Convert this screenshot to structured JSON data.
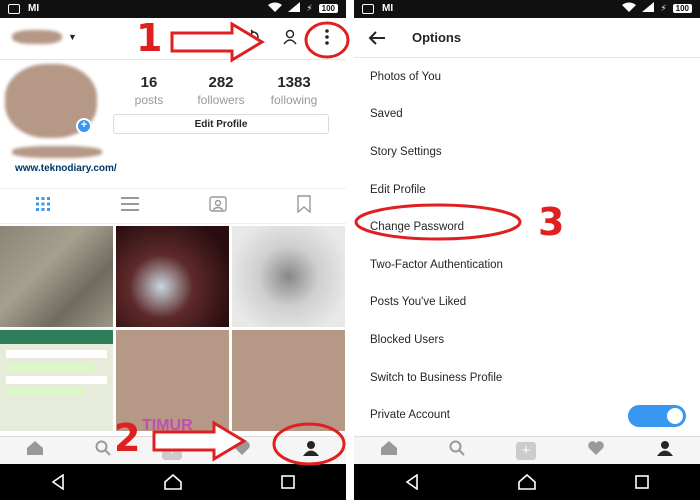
{
  "left_phone": {
    "status_bar": {
      "brand": "MI",
      "battery": "100"
    },
    "profile": {
      "posts_count": "16",
      "posts_label": "posts",
      "followers_count": "282",
      "followers_label": "followers",
      "following_count": "1383",
      "following_label": "following",
      "edit_button": "Edit Profile",
      "website": "www.teknodiary.com/"
    },
    "photo_overlay_text": "TIMUR"
  },
  "right_phone": {
    "status_bar": {
      "brand": "MI",
      "battery": "100"
    },
    "title": "Options",
    "items": [
      {
        "label": "Photos of You"
      },
      {
        "label": "Saved"
      },
      {
        "label": "Story Settings"
      },
      {
        "label": "Edit Profile"
      },
      {
        "label": "Change Password"
      },
      {
        "label": "Two-Factor Authentication"
      },
      {
        "label": "Posts You've Liked"
      },
      {
        "label": "Blocked Users"
      },
      {
        "label": "Switch to Business Profile"
      },
      {
        "label": "Private Account"
      }
    ]
  },
  "annotations": {
    "step1": "1",
    "step2": "2",
    "step3": "3"
  },
  "colors": {
    "annotation_red": "#e02020",
    "toggle_blue": "#3897f0",
    "link_blue": "#003569"
  }
}
